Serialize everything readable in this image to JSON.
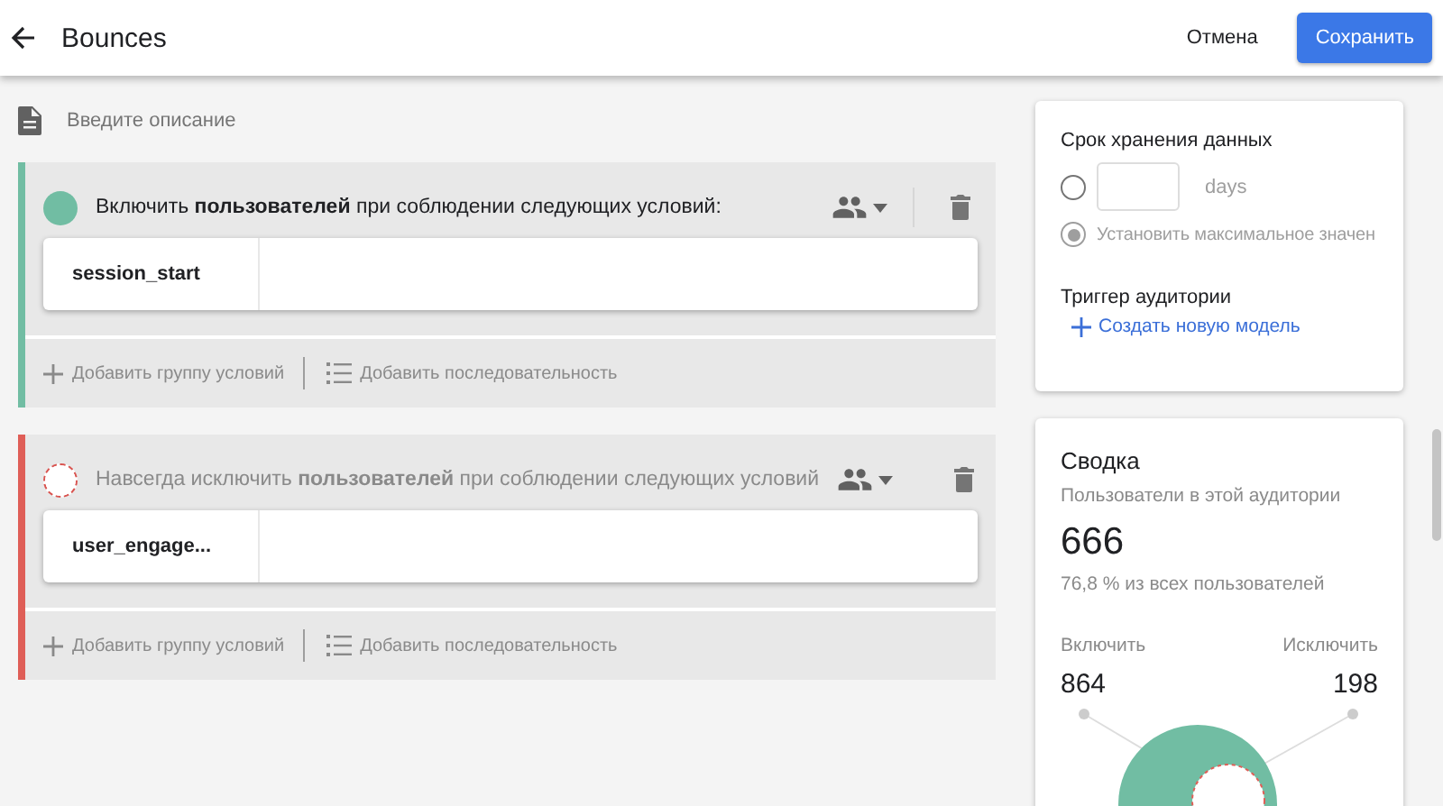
{
  "header": {
    "title": "Bounces",
    "cancel": "Отмена",
    "save": "Сохранить"
  },
  "description": {
    "placeholder": "Введите описание"
  },
  "groups": [
    {
      "kind": "include",
      "title": "Включить **пользователей** при соблюдении следующих условий:",
      "condition": "session_start",
      "add_group": "Добавить группу условий",
      "add_sequence": "Добавить последовательность"
    },
    {
      "kind": "exclude",
      "title": "Навсегда исключить **пользователей** при соблюдении следующих условий",
      "condition": "user_engage...",
      "add_group": "Добавить группу условий",
      "add_sequence": "Добавить последовательность"
    }
  ],
  "retention": {
    "title": "Срок хранения данных",
    "options": [
      {
        "kind": "days",
        "selected": false,
        "unit": "days"
      },
      {
        "kind": "max",
        "selected": true,
        "label": "Установить максимальное значен"
      }
    ]
  },
  "trigger": {
    "title": "Триггер аудитории",
    "link": "Создать новую модель"
  },
  "summary": {
    "title": "Сводка",
    "subtitle": "Пользователи в этой аудитории",
    "count": "666",
    "share": "76,8 % из всех пользователей",
    "include_label": "Включить",
    "include_value": "864",
    "exclude_label": "Исключить",
    "exclude_value": "198"
  }
}
